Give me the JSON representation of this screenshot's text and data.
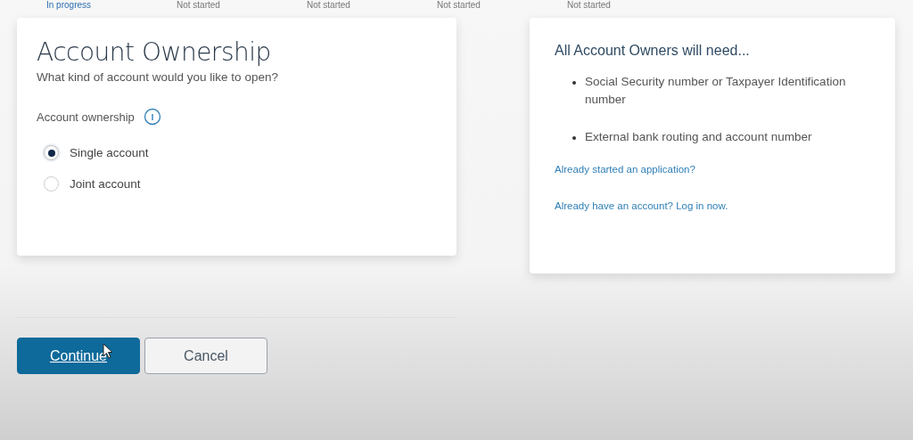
{
  "steps": [
    {
      "label": "In progress",
      "selected": true
    },
    {
      "label": "Not started",
      "selected": false
    },
    {
      "label": "Not started",
      "selected": false
    },
    {
      "label": "Not started",
      "selected": false
    },
    {
      "label": "Not started",
      "selected": false
    }
  ],
  "form": {
    "title": "Account Ownership",
    "subtitle": "What kind of account would you like to open?",
    "field_label": "Account ownership",
    "options": [
      {
        "label": "Single account",
        "selected": true
      },
      {
        "label": "Joint account",
        "selected": false
      }
    ]
  },
  "info": {
    "title": "All Account Owners will need...",
    "items": [
      "Social Security number or Taxpayer Identification number",
      "External bank routing and account number"
    ],
    "links": [
      "Already started an application?",
      "Already have an account? Log in now."
    ]
  },
  "buttons": [
    {
      "label": "Continue",
      "kind": "primary"
    },
    {
      "label": "Cancel",
      "kind": "secondary"
    }
  ]
}
